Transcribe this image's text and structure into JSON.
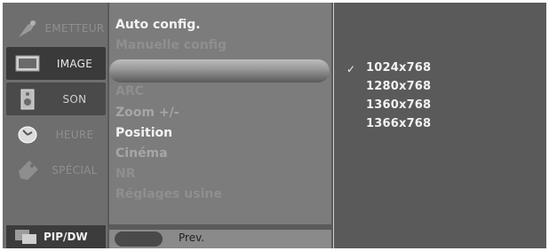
{
  "sidebar": {
    "items": [
      {
        "label": "EMETTEUR",
        "icon": "antenna-icon"
      },
      {
        "label": "IMAGE",
        "icon": "monitor-icon"
      },
      {
        "label": "SON",
        "icon": "speaker-icon"
      },
      {
        "label": "HEURE",
        "icon": "clock-icon"
      },
      {
        "label": "SPÉCIAL",
        "icon": "tag-icon"
      }
    ],
    "pip_label": "PIP/DW"
  },
  "menu": {
    "items": [
      {
        "label": "Auto config."
      },
      {
        "label": "Manuelle config"
      },
      {
        "label": ""
      },
      {
        "label": "ARC"
      },
      {
        "label": "Zoom +/-"
      },
      {
        "label": "Position"
      },
      {
        "label": "Cinéma"
      },
      {
        "label": "NR"
      },
      {
        "label": "Réglages usine"
      }
    ],
    "prev_label": "Prev."
  },
  "submenu": {
    "selected": "1024x768",
    "check_mark": "✓",
    "options": [
      "1024x768",
      "1280x768",
      "1360x768",
      "1366x768"
    ]
  }
}
